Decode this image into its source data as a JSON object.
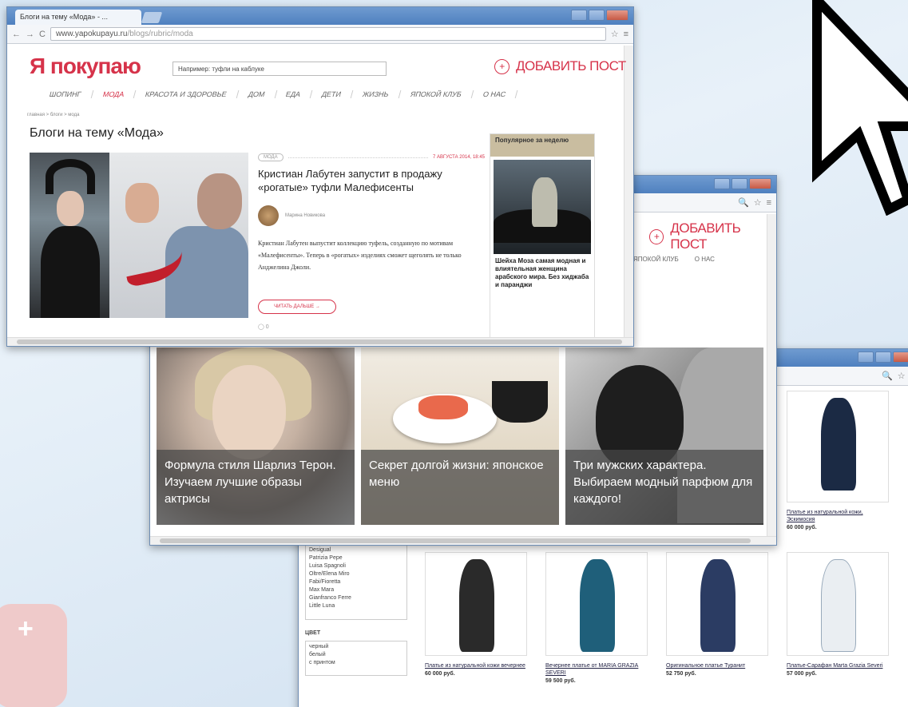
{
  "window_front": {
    "tab_title": "Блоги на тему «Мода» - ...",
    "url_host": "www.yapokupayu.ru",
    "url_path": "/blogs/rubric/moda",
    "logo": "Я покупаю",
    "logo_sub": "",
    "search_placeholder": "Например: туфли на каблуке",
    "add_post": "ДОБАВИТЬ ПОСТ",
    "nav": [
      "ШОПИНГ",
      "МОДА",
      "КРАСОТА И ЗДОРОВЬЕ",
      "ДОМ",
      "ЕДА",
      "ДЕТИ",
      "ЖИЗНЬ",
      "ЯПОКОЙ КЛУБ",
      "О НАС"
    ],
    "nav_active_index": 1,
    "breadcrumb": "главная > блоги > мода",
    "page_title": "Блоги на тему «Мода»",
    "article": {
      "tag": "МОДА",
      "date": "7 АВГУСТА 2014, 18:45",
      "title": "Кристиан Лабутен запустит в продажу «рогатые» туфли Малефисенты",
      "author": "Марина Новикова",
      "text": "Кристиан Лабутен выпустит коллекцию туфель, созданную по мотивам «Малефисенты». Теперь в «рогатых» изделиях сможет щеголять не только Анджелина Джоли.",
      "more": "ЧИТАТЬ ДАЛЬШЕ →",
      "comments": "0"
    },
    "popular": {
      "header": "Популярное за неделю",
      "text": "Шейха Моза самая модная и влиятельная женщина арабского мира. Без хиджаба и паранджи"
    }
  },
  "window_middle": {
    "add_post": "ДОБАВИТЬ ПОСТ",
    "nav": [
      "ЯПОКОЙ КЛУБ",
      "О НАС"
    ],
    "slides": [
      "Формула стиля Шарлиз Терон. Изучаем лучшие образы актрисы",
      "Секрет долгой жизни: японское меню",
      "Три мужских характера. Выбираем модный парфюм для каждого!"
    ]
  },
  "window_back": {
    "brands": [
      "Desigual",
      "Patrizia Pepe",
      "Luisa Spagnoli",
      "Oltre/Elena Miro",
      "Fabi/Fioretta",
      "Max Mara",
      "Gianfranco Ferre",
      "Little Luna"
    ],
    "color_header": "ЦВЕТ",
    "colors": [
      "черный",
      "белый",
      "с принтом"
    ],
    "products": [
      {
        "name": "Платье из натуральной кожи, Эскимосия",
        "price": "60 000 руб.",
        "color": "#1b2a44"
      },
      {
        "name": "Платье из натуральной кожи вечернее",
        "price": "60 000 руб.",
        "color": "#2a2a2a"
      },
      {
        "name": "Вечернее платье от MARIA GRAZIA SEVERI",
        "price": "59 500 руб.",
        "color": "#1f5f7a"
      },
      {
        "name": "Оригинальное платье Туранит",
        "price": "52 750 руб.",
        "color": "#2b3c63"
      },
      {
        "name": "Платье-Сарафан Marta Grazia Severi",
        "price": "57 000 руб.",
        "color": "#eaeef2"
      }
    ]
  },
  "colors": {
    "accent": "#d6334a",
    "titlebar": "#4f80bf",
    "desktop": "#dbe8f4"
  }
}
